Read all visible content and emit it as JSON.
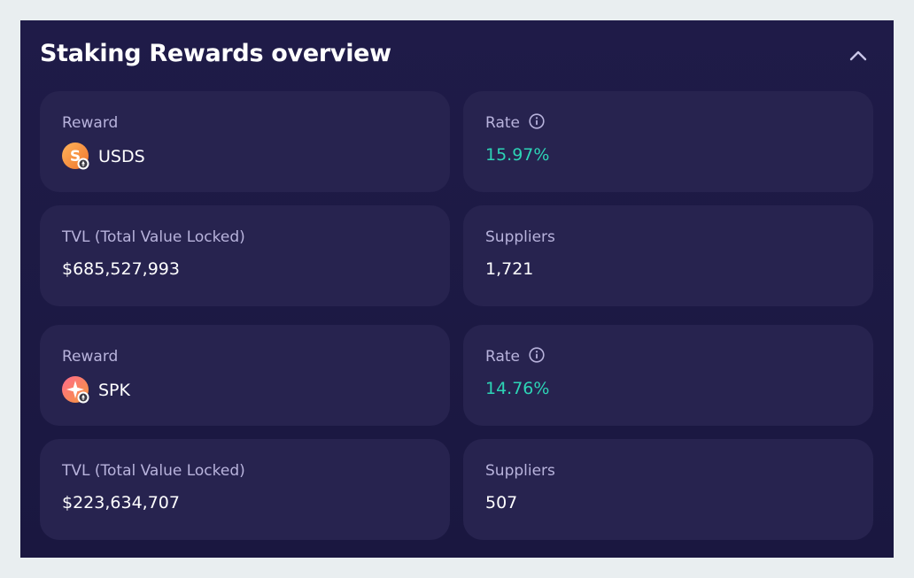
{
  "header": {
    "title": "Staking Rewards overview"
  },
  "colors": {
    "panel_bg": "#1f1b48",
    "card_bg": "#27234f",
    "rate_green": "#2dd4b6",
    "label_gray": "#b8b3dc"
  },
  "rewards": [
    {
      "reward_label": "Reward",
      "token": "USDS",
      "token_icon": "usds-token-icon",
      "rate_label": "Rate",
      "rate": "15.97%",
      "tvl_label": "TVL (Total Value Locked)",
      "tvl": "$685,527,993",
      "suppliers_label": "Suppliers",
      "suppliers": "1,721"
    },
    {
      "reward_label": "Reward",
      "token": "SPK",
      "token_icon": "spk-token-icon",
      "rate_label": "Rate",
      "rate": "14.76%",
      "tvl_label": "TVL (Total Value Locked)",
      "tvl": "$223,634,707",
      "suppliers_label": "Suppliers",
      "suppliers": "507"
    }
  ]
}
